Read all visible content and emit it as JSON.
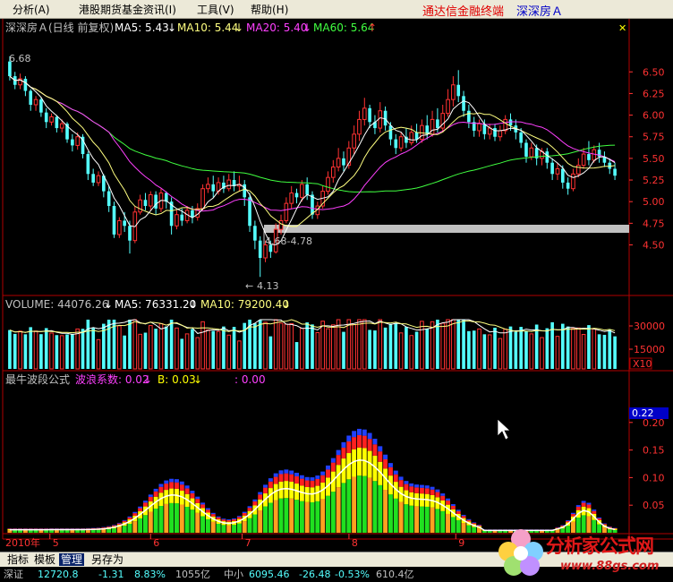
{
  "menubar": {
    "items": [
      "分析(A)",
      "港股期货基金",
      "资讯(I)",
      "工具(V)",
      "帮助(H)"
    ],
    "brand": "通达信金融终端",
    "stock": "深深房Ａ"
  },
  "price_panel": {
    "title": "深深房Ａ(日线 前复权)",
    "ma5": "MA5: 5.43",
    "ma10": "MA10: 5.44",
    "ma20": "MA20: 5.40",
    "ma60": "MA60: 5.64",
    "high_label": "6.68",
    "low_label": "4.13",
    "range_label": "4.68-4.78",
    "y_labels": [
      "6.50",
      "6.25",
      "6.00",
      "5.75",
      "5.50",
      "5.25",
      "5.00",
      "4.75",
      "4.50"
    ]
  },
  "volume_panel": {
    "title": "VOLUME: 44076.26",
    "ma5": "MA5: 76331.20",
    "ma10": "MA10: 79200.40",
    "y_labels": [
      "30000",
      "15000"
    ],
    "unit": "X10"
  },
  "indicator_panel": {
    "title": "最牛波段公式",
    "bolang": "波浪系数: 0.02",
    "b": "B: 0.03",
    "extra": ": 0.00",
    "current": "0.22",
    "y_labels": [
      "0.20",
      "0.15",
      "0.10",
      "0.05"
    ]
  },
  "x_axis": {
    "labels": [
      "2010年",
      "5",
      "6",
      "7",
      "8",
      "9"
    ]
  },
  "tabs": [
    "指标",
    "模板",
    "管理",
    "另存为"
  ],
  "status": {
    "name": "深证",
    "val1": "12720.8",
    "val2": "-1.31",
    "val3": "8.83%",
    "val4": "1055亿",
    "name2": "中小",
    "val5": "6095.46",
    "val6": "-26.48",
    "val7": "-0.53%",
    "val8": "610.4亿"
  },
  "watermark": {
    "title": "分析家公式网",
    "url": "www.88gs.com"
  },
  "chart_data": {
    "type": "candlestick",
    "x_month_labels": [
      "5",
      "6",
      "7",
      "8",
      "9"
    ],
    "ylim": [
      4.05,
      6.72
    ],
    "candles": [
      [
        6.62,
        6.45,
        6.68,
        6.4
      ],
      [
        6.45,
        6.35,
        6.5,
        6.3
      ],
      [
        6.35,
        6.42,
        6.48,
        6.3
      ],
      [
        6.42,
        6.28,
        6.45,
        6.22
      ],
      [
        6.28,
        6.12,
        6.3,
        6.05
      ],
      [
        6.12,
        6.18,
        6.22,
        6.05
      ],
      [
        6.18,
        6.03,
        6.2,
        5.98
      ],
      [
        6.03,
        5.92,
        6.08,
        5.85
      ],
      [
        5.92,
        5.98,
        6.02,
        5.88
      ],
      [
        5.98,
        5.85,
        6.0,
        5.8
      ],
      [
        5.85,
        5.9,
        5.95,
        5.8
      ],
      [
        5.9,
        5.72,
        5.92,
        5.68
      ],
      [
        5.72,
        5.65,
        5.78,
        5.58
      ],
      [
        5.65,
        5.75,
        5.8,
        5.6
      ],
      [
        5.75,
        5.55,
        5.78,
        5.5
      ],
      [
        5.55,
        5.32,
        5.58,
        5.25
      ],
      [
        5.32,
        5.22,
        5.38,
        5.18
      ],
      [
        5.22,
        5.3,
        5.35,
        5.18
      ],
      [
        5.3,
        5.12,
        5.32,
        5.05
      ],
      [
        5.12,
        4.95,
        5.18,
        4.88
      ],
      [
        4.95,
        4.62,
        5.0,
        4.58
      ],
      [
        4.62,
        4.78,
        4.82,
        4.58
      ],
      [
        4.78,
        4.72,
        4.88,
        4.65
      ],
      [
        4.72,
        4.55,
        4.78,
        4.4
      ],
      [
        4.55,
        4.88,
        4.95,
        4.52
      ],
      [
        4.88,
        5.02,
        5.08,
        4.85
      ],
      [
        5.02,
        4.95,
        5.1,
        4.9
      ],
      [
        4.95,
        5.08,
        5.12,
        4.9
      ],
      [
        5.08,
        4.92,
        5.12,
        4.85
      ],
      [
        4.92,
        5.1,
        5.15,
        4.88
      ],
      [
        5.1,
        5.0,
        5.12,
        4.92
      ],
      [
        5.0,
        4.72,
        5.05,
        4.62
      ],
      [
        4.72,
        4.85,
        4.9,
        4.68
      ],
      [
        4.85,
        4.78,
        4.92,
        4.72
      ],
      [
        4.78,
        4.9,
        4.95,
        4.75
      ],
      [
        4.9,
        4.82,
        4.95,
        4.75
      ],
      [
        4.82,
        4.92,
        4.98,
        4.78
      ],
      [
        4.92,
        5.15,
        5.2,
        4.9
      ],
      [
        5.15,
        5.2,
        5.28,
        5.1
      ],
      [
        5.2,
        5.12,
        5.3,
        5.05
      ],
      [
        5.12,
        5.22,
        5.28,
        5.08
      ],
      [
        5.22,
        5.15,
        5.3,
        5.1
      ],
      [
        5.15,
        5.25,
        5.32,
        5.12
      ],
      [
        5.25,
        5.18,
        5.35,
        5.12
      ],
      [
        5.18,
        5.2,
        5.3,
        5.12
      ],
      [
        5.2,
        5.05,
        5.25,
        4.95
      ],
      [
        5.05,
        4.72,
        5.1,
        4.65
      ],
      [
        4.72,
        4.55,
        4.78,
        4.45
      ],
      [
        4.55,
        4.35,
        4.6,
        4.13
      ],
      [
        4.35,
        4.5,
        4.55,
        4.3
      ],
      [
        4.5,
        4.42,
        4.55,
        4.35
      ],
      [
        4.42,
        4.68,
        4.75,
        4.4
      ],
      [
        4.68,
        4.78,
        4.85,
        4.62
      ],
      [
        4.78,
        4.98,
        5.05,
        4.75
      ],
      [
        4.98,
        5.1,
        5.18,
        4.92
      ],
      [
        5.1,
        5.05,
        5.15,
        4.98
      ],
      [
        5.05,
        5.2,
        5.25,
        5.0
      ],
      [
        5.2,
        5.08,
        5.28,
        5.02
      ],
      [
        5.08,
        4.85,
        5.12,
        4.8
      ],
      [
        4.85,
        4.95,
        5.0,
        4.8
      ],
      [
        4.95,
        5.12,
        5.18,
        4.92
      ],
      [
        5.12,
        5.28,
        5.35,
        5.08
      ],
      [
        5.28,
        5.4,
        5.48,
        5.22
      ],
      [
        5.4,
        5.5,
        5.62,
        5.35
      ],
      [
        5.5,
        5.42,
        5.58,
        5.35
      ],
      [
        5.42,
        5.62,
        5.7,
        5.38
      ],
      [
        5.62,
        5.78,
        5.88,
        5.55
      ],
      [
        5.78,
        5.95,
        6.05,
        5.7
      ],
      [
        5.95,
        6.08,
        6.2,
        5.88
      ],
      [
        6.08,
        5.92,
        6.12,
        5.85
      ],
      [
        5.92,
        5.85,
        6.0,
        5.78
      ],
      [
        5.85,
        6.05,
        6.15,
        5.8
      ],
      [
        6.05,
        5.88,
        6.1,
        5.82
      ],
      [
        5.88,
        5.72,
        5.92,
        5.65
      ],
      [
        5.72,
        5.62,
        5.78,
        5.55
      ],
      [
        5.62,
        5.75,
        5.8,
        5.58
      ],
      [
        5.75,
        5.68,
        5.85,
        5.62
      ],
      [
        5.68,
        5.8,
        5.88,
        5.65
      ],
      [
        5.8,
        5.72,
        5.9,
        5.68
      ],
      [
        5.72,
        5.88,
        5.95,
        5.68
      ],
      [
        5.88,
        5.78,
        6.0,
        5.72
      ],
      [
        5.78,
        5.95,
        6.05,
        5.75
      ],
      [
        5.95,
        5.85,
        6.08,
        5.8
      ],
      [
        5.85,
        6.02,
        6.12,
        5.8
      ],
      [
        6.02,
        6.18,
        6.3,
        5.98
      ],
      [
        6.18,
        6.35,
        6.45,
        6.1
      ],
      [
        6.35,
        6.22,
        6.52,
        6.15
      ],
      [
        6.22,
        6.05,
        6.28,
        5.98
      ],
      [
        6.05,
        5.92,
        6.12,
        5.85
      ],
      [
        5.92,
        5.82,
        5.98,
        5.75
      ],
      [
        5.82,
        5.9,
        5.95,
        5.75
      ],
      [
        5.9,
        5.78,
        5.95,
        5.72
      ],
      [
        5.78,
        5.85,
        5.9,
        5.72
      ],
      [
        5.85,
        5.75,
        5.9,
        5.7
      ],
      [
        5.75,
        5.82,
        5.88,
        5.7
      ],
      [
        5.82,
        5.95,
        6.0,
        5.78
      ],
      [
        5.95,
        5.88,
        6.02,
        5.82
      ],
      [
        5.88,
        5.8,
        5.95,
        5.72
      ],
      [
        5.8,
        5.68,
        5.85,
        5.62
      ],
      [
        5.68,
        5.52,
        5.72,
        5.45
      ],
      [
        5.52,
        5.62,
        5.68,
        5.48
      ],
      [
        5.62,
        5.5,
        5.66,
        5.42
      ],
      [
        5.5,
        5.58,
        5.62,
        5.42
      ],
      [
        5.58,
        5.45,
        5.62,
        5.38
      ],
      [
        5.45,
        5.32,
        5.5,
        5.25
      ],
      [
        5.32,
        5.38,
        5.45,
        5.25
      ],
      [
        5.38,
        5.22,
        5.42,
        5.15
      ],
      [
        5.22,
        5.15,
        5.28,
        5.08
      ],
      [
        5.15,
        5.32,
        5.38,
        5.12
      ],
      [
        5.32,
        5.42,
        5.5,
        5.28
      ],
      [
        5.42,
        5.55,
        5.62,
        5.38
      ],
      [
        5.55,
        5.48,
        5.7,
        5.42
      ],
      [
        5.48,
        5.6,
        5.65,
        5.45
      ],
      [
        5.6,
        5.52,
        5.68,
        5.45
      ],
      [
        5.52,
        5.45,
        5.58,
        5.4
      ],
      [
        5.45,
        5.38,
        5.5,
        5.32
      ],
      [
        5.38,
        5.3,
        5.45,
        5.25
      ]
    ],
    "ma_colors": {
      "ma5": "#ffffff",
      "ma10": "#ffff80",
      "ma20": "#ff40ff",
      "ma60": "#40ff40"
    },
    "up_color": "#ff3232",
    "down_color": "#54ffff"
  }
}
